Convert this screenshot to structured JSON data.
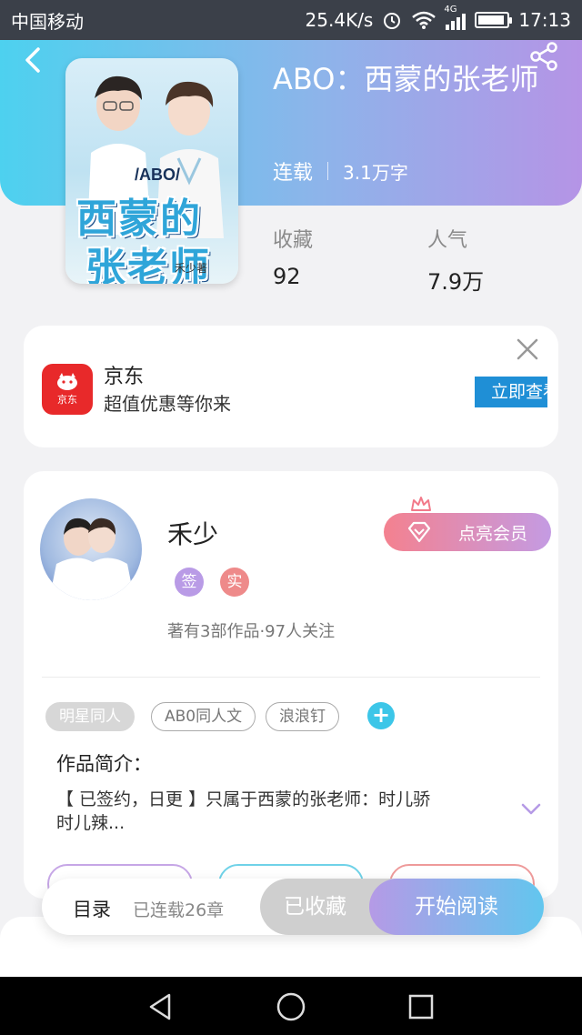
{
  "status_bar": {
    "carrier": "中国移动",
    "speed": "25.4K/s",
    "network": "4G",
    "time": "17:13"
  },
  "book": {
    "title": "ABO：西蒙的张老师",
    "status": "连载",
    "word_count": "3.1万字",
    "cover": {
      "tag": "/ABO/",
      "line1": "西蒙的",
      "line2": "张老师",
      "author_mark": "禾少著"
    },
    "stats": {
      "favorites_label": "收藏",
      "favorites_value": "92",
      "popularity_label": "人气",
      "popularity_value": "7.9万"
    }
  },
  "ad": {
    "brand": "京东",
    "logo_text": "京东",
    "desc": "超值优惠等你来",
    "button": "立即查看"
  },
  "author": {
    "name": "禾少",
    "badges": [
      "签",
      "实"
    ],
    "works_line": "著有3部作品·97人关注",
    "vip_button": "点亮会员"
  },
  "tags": [
    "明星同人",
    "AB0同人文",
    "浪浪钉"
  ],
  "intro": {
    "title": "作品简介：",
    "text": "【 已签约，日更 】只属于西蒙的张老师：时儿骄时儿辣..."
  },
  "bottom_bar": {
    "toc_label": "目录",
    "toc_count": "已连载26章",
    "saved_button": "已收藏",
    "read_button": "开始阅读"
  },
  "colors": {
    "header_start": "#4dd1ef",
    "header_end": "#b594e6",
    "jd_red": "#e8292a",
    "ad_button": "#1f8fd6"
  }
}
